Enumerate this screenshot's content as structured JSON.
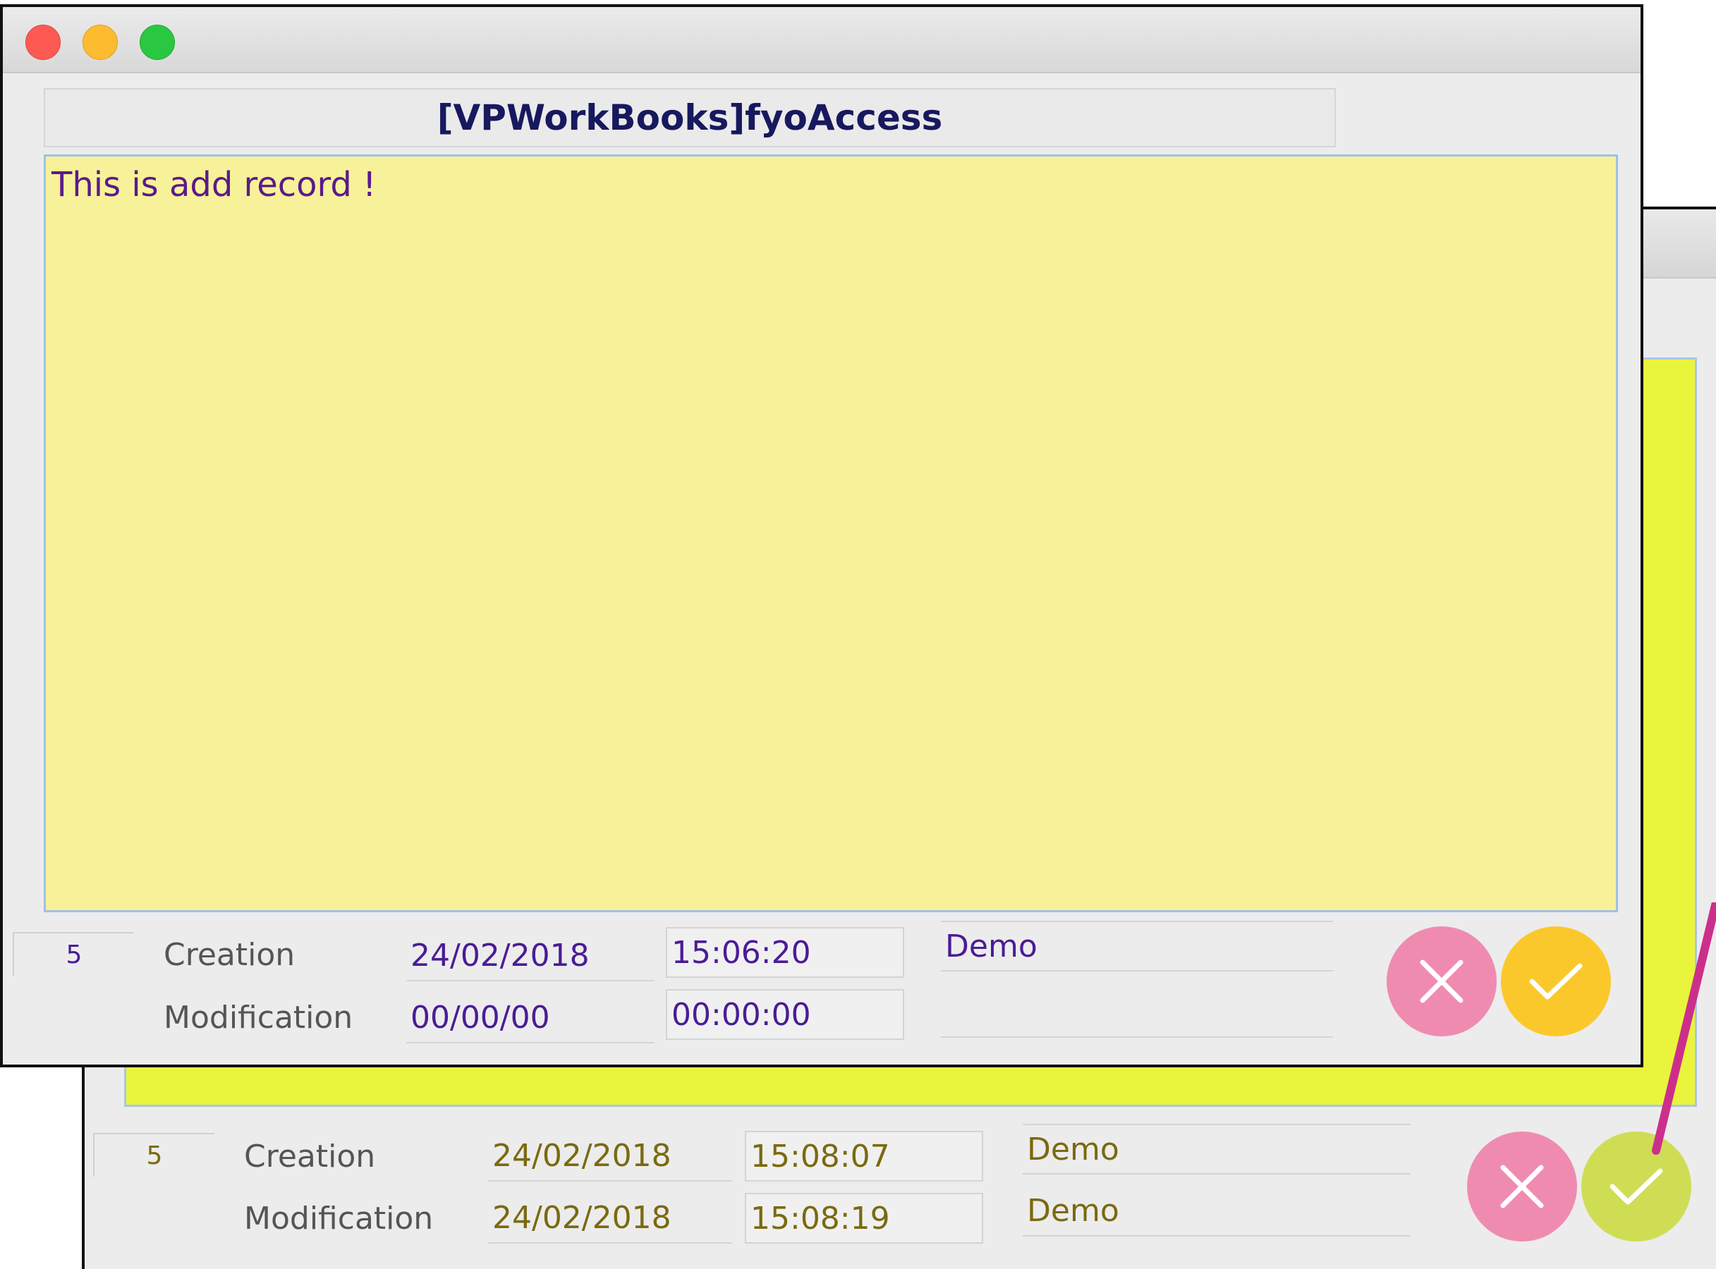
{
  "background_window": {
    "record_id": "5",
    "creation_label": "Creation",
    "creation_date": "24/02/2018",
    "creation_time": "15:08:07",
    "creation_user": "Demo",
    "modification_label": "Modification",
    "modification_date": "24/02/2018",
    "modification_time": "15:08:19",
    "modification_user": "Demo",
    "note_color": "#e9f53c"
  },
  "foreground_window": {
    "title": "[VPWorkBooks]fyoAccess",
    "note_text": "This is add record !",
    "record_id": "5",
    "creation_label": "Creation",
    "creation_date": "24/02/2018",
    "creation_time": "15:06:20",
    "creation_user": "Demo",
    "modification_label": "Modification",
    "modification_date": "00/00/00",
    "modification_time": "00:00:00",
    "modification_user": "",
    "note_color": "#f7f199"
  },
  "icons": {
    "cancel": "close-x-icon",
    "validate": "checkmark-icon"
  },
  "colors": {
    "cancel_button": "#f08bb0",
    "validate_button_active": "#fbc82c",
    "validate_button_bg": "#cfdd55",
    "annotation_arrow": "#cc2f8a"
  }
}
